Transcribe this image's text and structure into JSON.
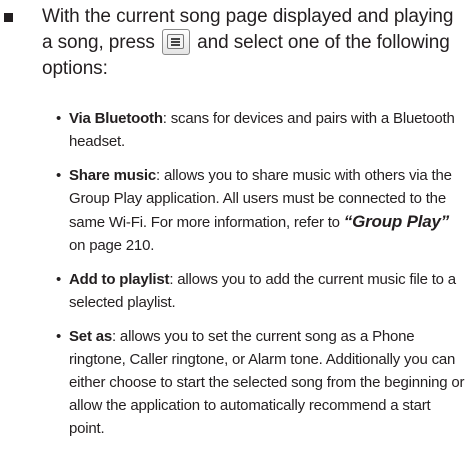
{
  "intro": {
    "before_key": "With the current song page displayed and playing a song, press",
    "menu_key_icon": "menu-key-icon",
    "after_key": "and select one of the following options:"
  },
  "options": [
    {
      "term": "Via Bluetooth",
      "desc": ": scans for devices and pairs with a Bluetooth headset."
    },
    {
      "term": "Share music",
      "desc_before_ref": ": allows you to share music with others via the Group Play application. All users must be connected to the same Wi-Fi. For more information, refer to ",
      "ref": "“Group Play”",
      "desc_after_ref": " on page 210."
    },
    {
      "term": "Add to playlist",
      "desc": ": allows you to add the current music file to a selected playlist."
    },
    {
      "term": "Set as",
      "desc": ": allows you to set the current song as a Phone ringtone, Caller ringtone, or Alarm tone. Additionally you can either choose to start the selected song from the beginning or allow the application to automatically recommend a start point."
    }
  ],
  "bullet_char": "•"
}
